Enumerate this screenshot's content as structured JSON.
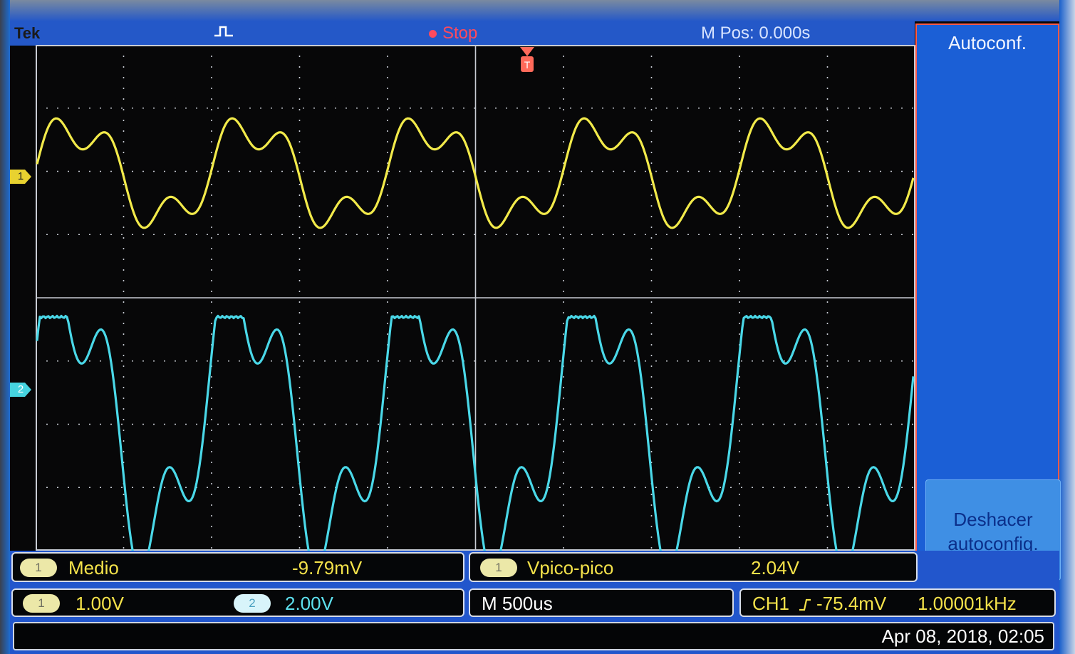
{
  "header": {
    "brand": "Tek",
    "acquisition_icon": "pulse-icon",
    "run_state": "Stop",
    "horizontal_position": "M Pos: 0.000s"
  },
  "side_menu": {
    "title": "Autoconf.",
    "undo_label_line1": "Deshacer",
    "undo_label_line2": "autoconfig."
  },
  "channel_markers": {
    "ch1": "1",
    "ch2": "2"
  },
  "measurements": [
    {
      "channel": "1",
      "name": "Medio",
      "value": "-9.79mV"
    },
    {
      "channel": "1",
      "name": "Vpico-pico",
      "value": "2.04V"
    }
  ],
  "status": {
    "ch1_badge": "1",
    "ch1_scale": "1.00V",
    "ch2_badge": "2",
    "ch2_scale": "2.00V",
    "timebase": "M 500us",
    "trigger_source": "CH1",
    "trigger_slope_icon": "rising-edge-icon",
    "trigger_level": "-75.4mV",
    "frequency": "1.00001kHz"
  },
  "datetime": "Apr 08, 2018, 02:05",
  "colors": {
    "ch1_trace": "#f2ea4a",
    "ch2_trace": "#4ad8e8",
    "trigger_marker": "#ff6a5a",
    "panel_blue": "#1b5fd6",
    "grid": "#c8ccd4"
  }
}
